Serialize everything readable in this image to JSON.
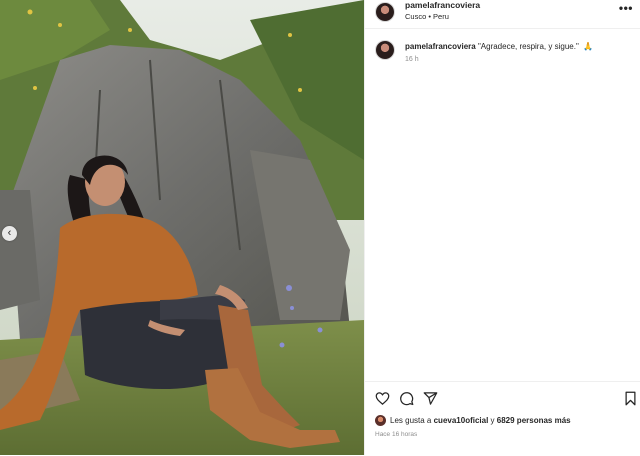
{
  "post": {
    "username": "pamelafrancoviera",
    "location": "Cusco • Peru",
    "caption": "\"Agradece, respira, y sigue.\"",
    "caption_time": "16 h",
    "likes_prefix": "Les gusta a",
    "likes_user": "cueva10oficial",
    "likes_middle": "y",
    "likes_count": "6829 personas más",
    "post_time": "Hace 16 horas"
  },
  "icons": {
    "more": "more-icon",
    "prev": "chevron-left-icon",
    "like": "heart-icon",
    "comment": "comment-icon",
    "share": "share-icon",
    "save": "bookmark-icon",
    "pray": "folded-hands-icon"
  },
  "colors": {
    "text": "#262626",
    "secondary": "#8e8e8e",
    "divider": "#efefef"
  }
}
